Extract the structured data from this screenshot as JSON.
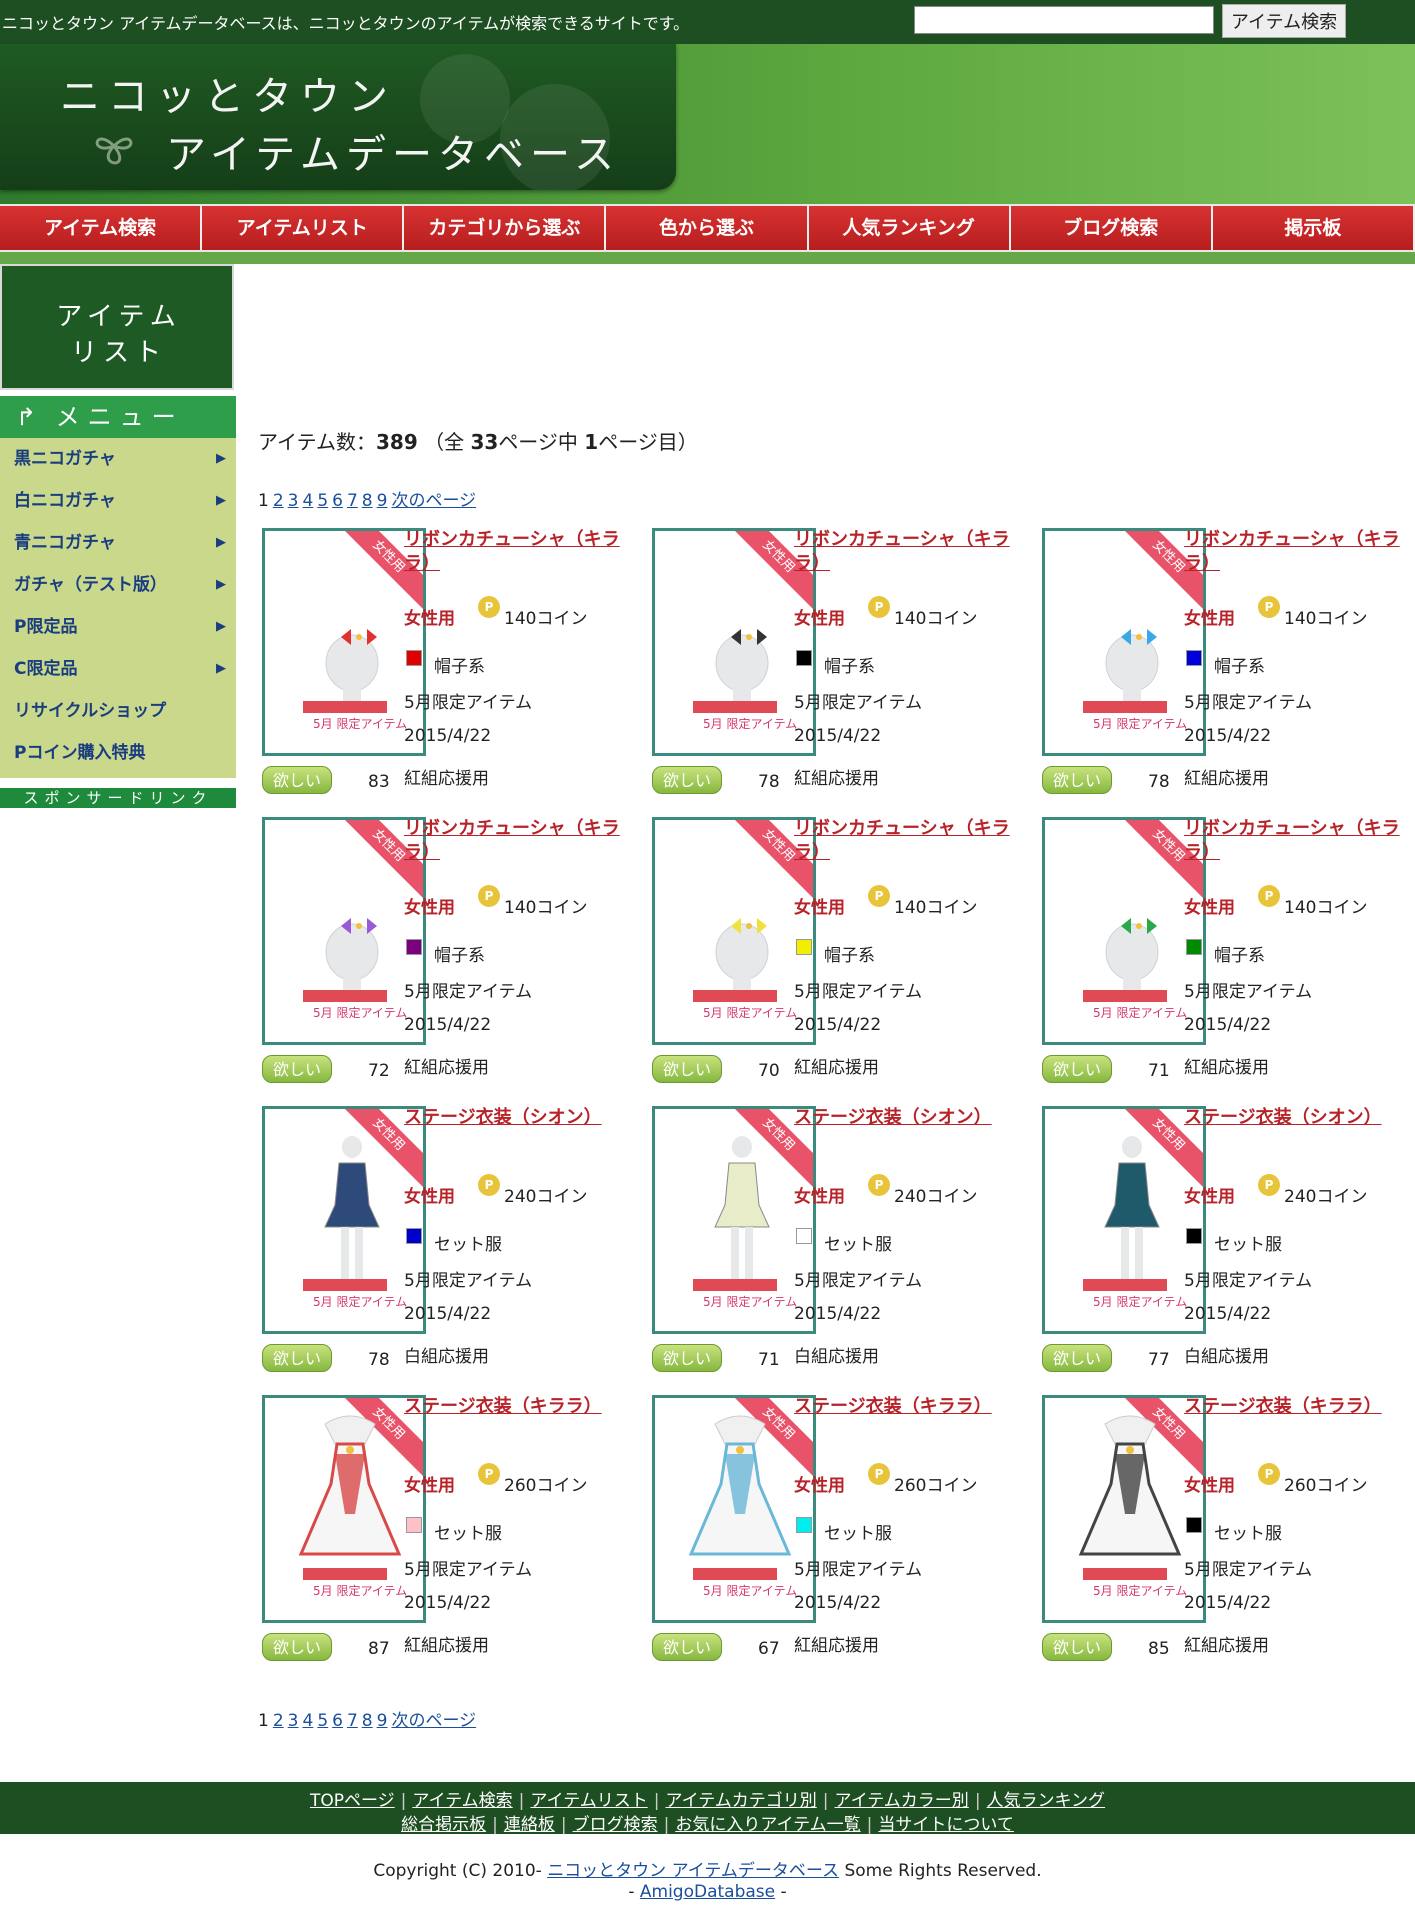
{
  "topbar": {
    "tagline": "ニコッとタウン アイテムデータベースは、ニコッとタウンのアイテムが検索できるサイトです。",
    "search_placeholder": "",
    "search_button": "アイテム検索"
  },
  "logo": {
    "line1": "ニコッとタウン",
    "line2": "アイテムデータベース"
  },
  "nav": [
    "アイテム検索",
    "アイテムリスト",
    "カテゴリから選ぶ",
    "色から選ぶ",
    "人気ランキング",
    "ブログ検索",
    "掲示板"
  ],
  "sidebar": {
    "title_line1": "アイテム",
    "title_line2": "リスト",
    "menu_title": "メニュー",
    "items": [
      "黒ニコガチャ",
      "白ニコガチャ",
      "青ニコガチャ",
      "ガチャ（テスト版）",
      "P限定品",
      "C限定品",
      "リサイクルショップ",
      "Pコイン購入特典"
    ],
    "sponsor": "スポンサードリンク"
  },
  "summary": {
    "label": "アイテム数：",
    "count": "389",
    "mid1": "（全 ",
    "pages": "33",
    "mid2": "ページ中 ",
    "current": "1",
    "end": "ページ目）"
  },
  "pager": {
    "current": "1",
    "pages": [
      "2",
      "3",
      "4",
      "5",
      "6",
      "7",
      "8",
      "9"
    ],
    "next": "次のページ"
  },
  "common": {
    "ribbon": "女性用",
    "gender": "女性用",
    "coin_letter": "P",
    "limited": "5月限定アイテム",
    "date": "2015/4/22",
    "want": "欲しい",
    "thumb_banner": "5月 限定アイテム"
  },
  "items": [
    {
      "name": "リボンカチューシャ（キララ）",
      "price": "140コイン",
      "color": "#e00000",
      "category": "帽子系",
      "team": "紅組応援用",
      "want": "83",
      "kind": "head",
      "accent": "#e03030"
    },
    {
      "name": "リボンカチューシャ（キララ）",
      "price": "140コイン",
      "color": "#000000",
      "category": "帽子系",
      "team": "紅組応援用",
      "want": "78",
      "kind": "head",
      "accent": "#333333"
    },
    {
      "name": "リボンカチューシャ（キララ）",
      "price": "140コイン",
      "color": "#0000dd",
      "category": "帽子系",
      "team": "紅組応援用",
      "want": "78",
      "kind": "head",
      "accent": "#3aa8e8"
    },
    {
      "name": "リボンカチューシャ（キララ）",
      "price": "140コイン",
      "color": "#7a0080",
      "category": "帽子系",
      "team": "紅組応援用",
      "want": "72",
      "kind": "head",
      "accent": "#9a5ad8"
    },
    {
      "name": "リボンカチューシャ（キララ）",
      "price": "140コイン",
      "color": "#f2ee00",
      "category": "帽子系",
      "team": "紅組応援用",
      "want": "70",
      "kind": "head",
      "accent": "#f0e040"
    },
    {
      "name": "リボンカチューシャ（キララ）",
      "price": "140コイン",
      "color": "#008a00",
      "category": "帽子系",
      "team": "紅組応援用",
      "want": "71",
      "kind": "head",
      "accent": "#2aa84a"
    },
    {
      "name": "ステージ衣装（シオン）",
      "price": "240コイン",
      "color": "#0000cc",
      "category": "セット服",
      "team": "白組応援用",
      "want": "78",
      "kind": "dress",
      "accent": "#2e4a7a"
    },
    {
      "name": "ステージ衣装（シオン）",
      "price": "240コイン",
      "color": "#ffffff",
      "category": "セット服",
      "team": "白組応援用",
      "want": "71",
      "kind": "dress",
      "accent": "#e8ecc8"
    },
    {
      "name": "ステージ衣装（シオン）",
      "price": "240コイン",
      "color": "#000000",
      "category": "セット服",
      "team": "白組応援用",
      "want": "77",
      "kind": "dress",
      "accent": "#1f5a6a"
    },
    {
      "name": "ステージ衣装（キララ）",
      "price": "260コイン",
      "color": "#ffc0c8",
      "category": "セット服",
      "team": "紅組応援用",
      "want": "87",
      "kind": "gown",
      "accent": "#d84a4a"
    },
    {
      "name": "ステージ衣装（キララ）",
      "price": "260コイン",
      "color": "#00eeee",
      "category": "セット服",
      "team": "紅組応援用",
      "want": "67",
      "kind": "gown",
      "accent": "#6ab8d8"
    },
    {
      "name": "ステージ衣装（キララ）",
      "price": "260コイン",
      "color": "#000000",
      "category": "セット服",
      "team": "紅組応援用",
      "want": "85",
      "kind": "gown",
      "accent": "#444444"
    }
  ],
  "footer": {
    "row1": [
      "TOPページ",
      "アイテム検索",
      "アイテムリスト",
      "アイテムカテゴリ別",
      "アイテムカラー別",
      "人気ランキング"
    ],
    "row2": [
      "総合掲示板",
      "連絡板",
      "ブログ検索",
      "お気に入りアイテム一覧",
      "当サイトについて"
    ],
    "copyright_pre": "Copyright (C) 2010- ",
    "copyright_link": "ニコッとタウン アイテムデータベース",
    "copyright_post": " Some Rights Reserved.",
    "amigo_pre": "- ",
    "amigo_link": "AmigoDatabase",
    "amigo_post": " -"
  }
}
